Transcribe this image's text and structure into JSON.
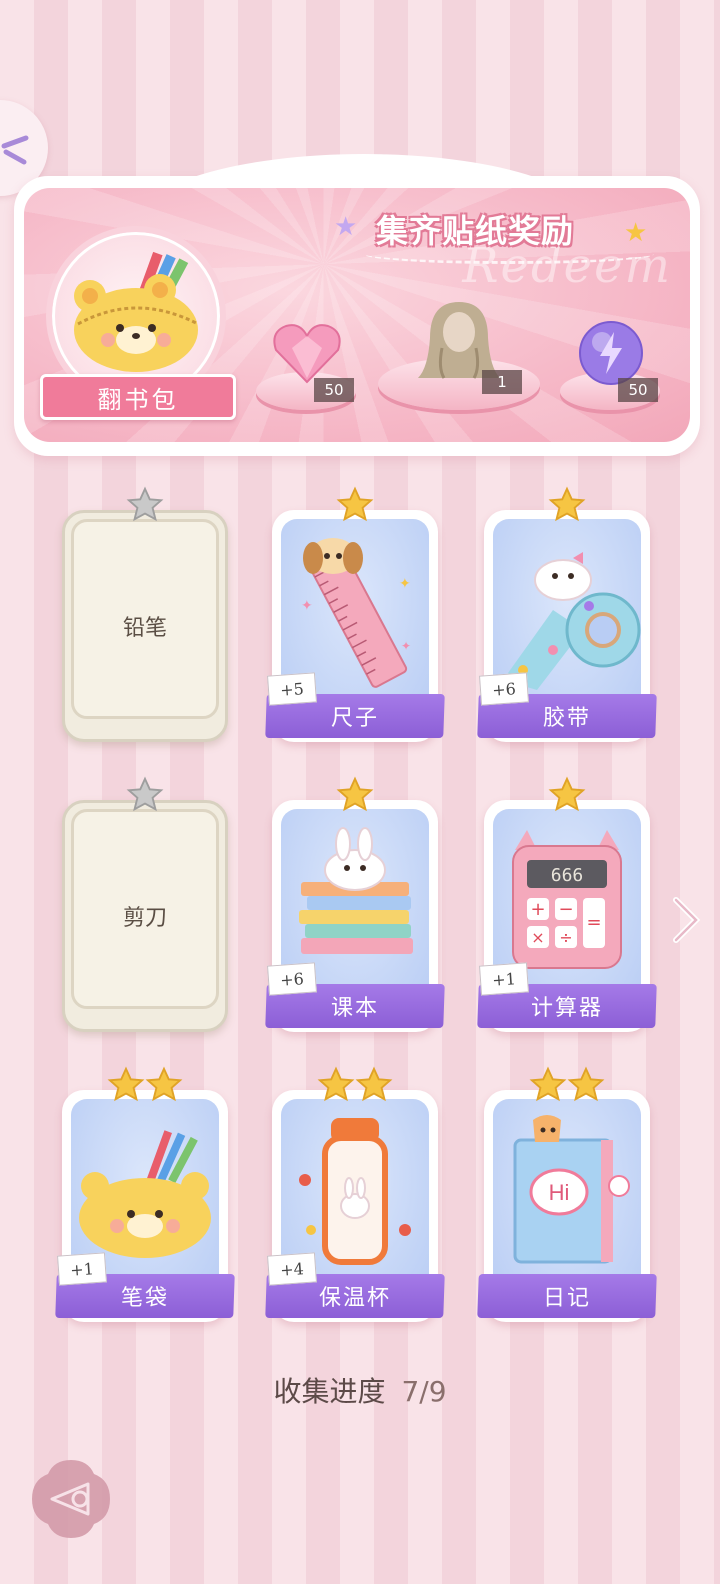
{
  "banner": {
    "title": "集齐贴纸奖励",
    "watermark": "Redeem",
    "bag_label": "翻书包",
    "rewards": [
      {
        "icon": "heart-gem-icon",
        "count": "50"
      },
      {
        "icon": "hairstyle-icon",
        "count": "1"
      },
      {
        "icon": "energy-orb-icon",
        "count": "50"
      }
    ]
  },
  "cards": [
    {
      "name": "铅笔",
      "locked": true,
      "stars": 1,
      "bonus": ""
    },
    {
      "name": "尺子",
      "locked": false,
      "stars": 1,
      "bonus": "+5",
      "icon": "ruler-icon"
    },
    {
      "name": "胶带",
      "locked": false,
      "stars": 1,
      "bonus": "+6",
      "icon": "tape-icon"
    },
    {
      "name": "剪刀",
      "locked": true,
      "stars": 1,
      "bonus": ""
    },
    {
      "name": "课本",
      "locked": false,
      "stars": 1,
      "bonus": "+6",
      "icon": "textbook-icon"
    },
    {
      "name": "计算器",
      "locked": false,
      "stars": 1,
      "bonus": "+1",
      "icon": "calculator-icon"
    },
    {
      "name": "笔袋",
      "locked": false,
      "stars": 2,
      "bonus": "+1",
      "icon": "pencil-case-icon"
    },
    {
      "name": "保温杯",
      "locked": false,
      "stars": 2,
      "bonus": "+4",
      "icon": "thermos-icon"
    },
    {
      "name": "日记",
      "locked": false,
      "stars": 2,
      "bonus": "",
      "icon": "diary-icon"
    }
  ],
  "calculator_display": "666",
  "diary_text": "Hi",
  "progress": {
    "label": "收集进度",
    "value": "7/9"
  },
  "colors": {
    "accent_purple": "#9a6de0",
    "pink": "#f07b9a",
    "gold_star": "#f6c543"
  }
}
